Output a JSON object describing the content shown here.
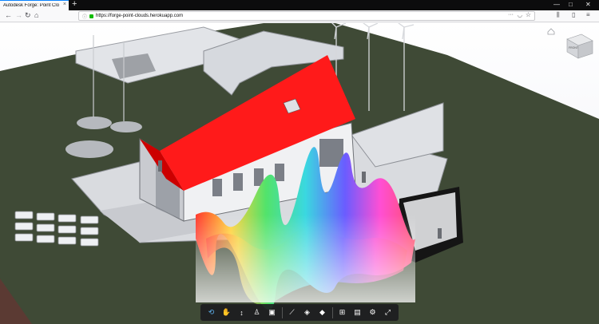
{
  "browser": {
    "tab_title": "Autodesk Forge: Point Cloud Demo",
    "tab_close": "×",
    "new_tab": "+",
    "url": "https://forge-point-clouds.herokuapp.com",
    "window_controls": [
      "—",
      "□",
      "✕"
    ]
  },
  "viewer": {
    "viewcube_label": "FRONT",
    "toolbar": {
      "tools": [
        {
          "name": "orbit",
          "icon": "orbit-icon"
        },
        {
          "name": "pan",
          "icon": "pan-icon"
        },
        {
          "name": "zoom",
          "icon": "zoom-icon"
        },
        {
          "name": "first-person",
          "icon": "first-person-icon"
        },
        {
          "name": "camera",
          "icon": "camera-icon"
        },
        {
          "name": "measure",
          "icon": "measure-icon"
        },
        {
          "name": "section",
          "icon": "section-icon"
        },
        {
          "name": "explode",
          "icon": "explode-icon"
        },
        {
          "name": "model-browser",
          "icon": "model-browser-icon"
        },
        {
          "name": "properties",
          "icon": "properties-icon"
        },
        {
          "name": "settings",
          "icon": "gear-icon"
        },
        {
          "name": "fullscreen",
          "icon": "fullscreen-icon"
        }
      ]
    }
  },
  "colors": {
    "roof": "#ff1a1a",
    "terrain": "#3f4a36",
    "toolbar_bg": "#1c1c20",
    "active_tool": "#5fb3f0"
  }
}
